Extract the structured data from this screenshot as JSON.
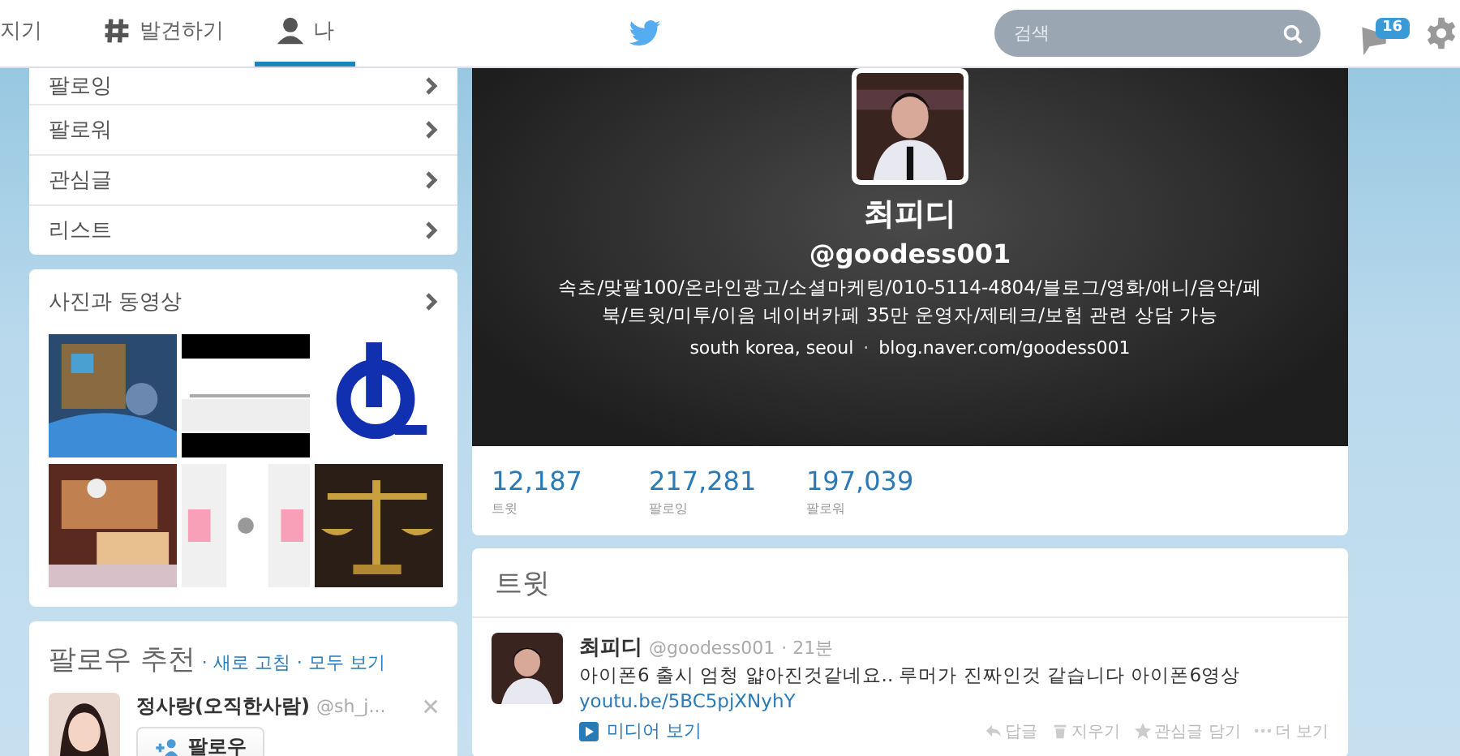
{
  "nav": {
    "items": [
      {
        "label": "지기",
        "kind": "text",
        "selected": false
      },
      {
        "label": "발견하기",
        "kind": "hashtag",
        "selected": false
      },
      {
        "label": "나",
        "kind": "person",
        "selected": true
      }
    ],
    "search": {
      "placeholder": "검색"
    },
    "notifications": {
      "count": "16"
    }
  },
  "sidebar": {
    "menu": [
      {
        "label": "팔로잉"
      },
      {
        "label": "팔로워"
      },
      {
        "label": "관심글"
      },
      {
        "label": "리스트"
      }
    ],
    "media": {
      "title": "사진과 동영상"
    },
    "suggestions": {
      "title": "팔로우 추천",
      "links": [
        "· 새로 고침",
        "· 모두 보기"
      ],
      "users": [
        {
          "name": "정사랑(오직한사람)",
          "handle": "@sh_j...",
          "button": "팔로우"
        }
      ]
    }
  },
  "profile": {
    "name": "최피디",
    "handle": "@goodess001",
    "bio": "속초/맞팔100/온라인광고/소셜마케팅/010-5114-4804/블로그/영화/애니/음악/페북/트윗/미투/이음 네이버카페 35만 운영자/제테크/보험 관련 상담 가능",
    "location": "south korea, seoul",
    "separator": "·",
    "url": "blog.naver.com/goodess001",
    "stats": [
      {
        "value": "12,187",
        "label": "트윗"
      },
      {
        "value": "217,281",
        "label": "팔로잉"
      },
      {
        "value": "197,039",
        "label": "팔로워"
      }
    ]
  },
  "timeline": {
    "title": "트윗",
    "tweets": [
      {
        "name": "최피디",
        "handle": "@goodess001",
        "time": "· 21분",
        "text": "아이폰6 출시 엄청 얇아진것같네요.. 루머가 진짜인것 같습니다 아이폰6영상",
        "link": "youtu.be/5BC5pjXNyhY",
        "media": "미디어 보기",
        "actions": [
          {
            "kind": "reply",
            "label": "답글"
          },
          {
            "kind": "delete",
            "label": "지우기"
          },
          {
            "kind": "favorite",
            "label": "관심글 담기"
          },
          {
            "kind": "more",
            "label": "더 보기"
          }
        ]
      }
    ]
  }
}
